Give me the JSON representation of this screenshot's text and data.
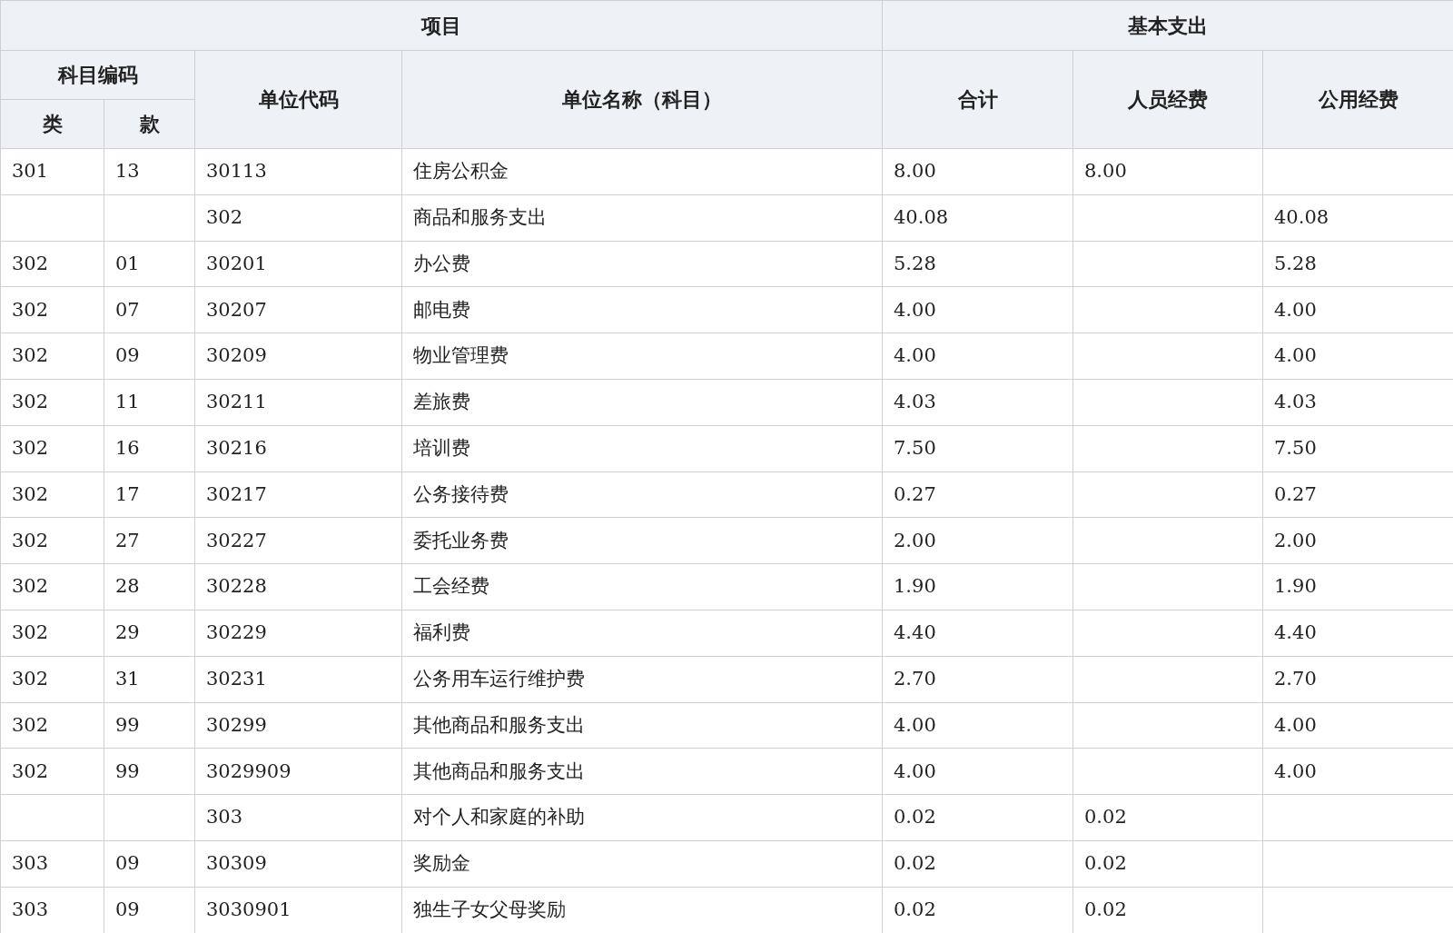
{
  "table": {
    "group_headers": [
      "项目",
      "基本支出"
    ],
    "subject_code_header": "科目编码",
    "columns": [
      "类",
      "款",
      "单位代码",
      "单位名称（科目）",
      "合计",
      "人员经费",
      "公用经费"
    ],
    "rows": [
      {
        "class": "301",
        "item": "13",
        "code": "30113",
        "name": "住房公积金",
        "total": "8.00",
        "personnel": "8.00"
      },
      {
        "code": "302",
        "name": "商品和服务支出",
        "total": "40.08",
        "public": "40.08"
      },
      {
        "class": "302",
        "item": "01",
        "code": "30201",
        "name": "办公费",
        "total": "5.28",
        "public": "5.28"
      },
      {
        "class": "302",
        "item": "07",
        "code": "30207",
        "name": "邮电费",
        "total": "4.00",
        "public": "4.00"
      },
      {
        "class": "302",
        "item": "09",
        "code": "30209",
        "name": "物业管理费",
        "total": "4.00",
        "public": "4.00"
      },
      {
        "class": "302",
        "item": "11",
        "code": "30211",
        "name": "差旅费",
        "total": "4.03",
        "public": "4.03"
      },
      {
        "class": "302",
        "item": "16",
        "code": "30216",
        "name": "培训费",
        "total": "7.50",
        "public": "7.50"
      },
      {
        "class": "302",
        "item": "17",
        "code": "30217",
        "name": "公务接待费",
        "total": "0.27",
        "public": "0.27"
      },
      {
        "class": "302",
        "item": "27",
        "code": "30227",
        "name": "委托业务费",
        "total": "2.00",
        "public": "2.00"
      },
      {
        "class": "302",
        "item": "28",
        "code": "30228",
        "name": "工会经费",
        "total": "1.90",
        "public": "1.90"
      },
      {
        "class": "302",
        "item": "29",
        "code": "30229",
        "name": "福利费",
        "total": "4.40",
        "public": "4.40"
      },
      {
        "class": "302",
        "item": "31",
        "code": "30231",
        "name": "公务用车运行维护费",
        "total": "2.70",
        "public": "2.70"
      },
      {
        "class": "302",
        "item": "99",
        "code": "30299",
        "name": "其他商品和服务支出",
        "total": "4.00",
        "public": "4.00"
      },
      {
        "class": "302",
        "item": "99",
        "code": "3029909",
        "name": "其他商品和服务支出",
        "total": "4.00",
        "public": "4.00"
      },
      {
        "code": "303",
        "name": "对个人和家庭的补助",
        "total": "0.02",
        "personnel": "0.02"
      },
      {
        "class": "303",
        "item": "09",
        "code": "30309",
        "name": "奖励金",
        "total": "0.02",
        "personnel": "0.02"
      },
      {
        "class": "303",
        "item": "09",
        "code": "3030901",
        "name": "独生子女父母奖励",
        "total": "0.02",
        "personnel": "0.02"
      }
    ]
  }
}
